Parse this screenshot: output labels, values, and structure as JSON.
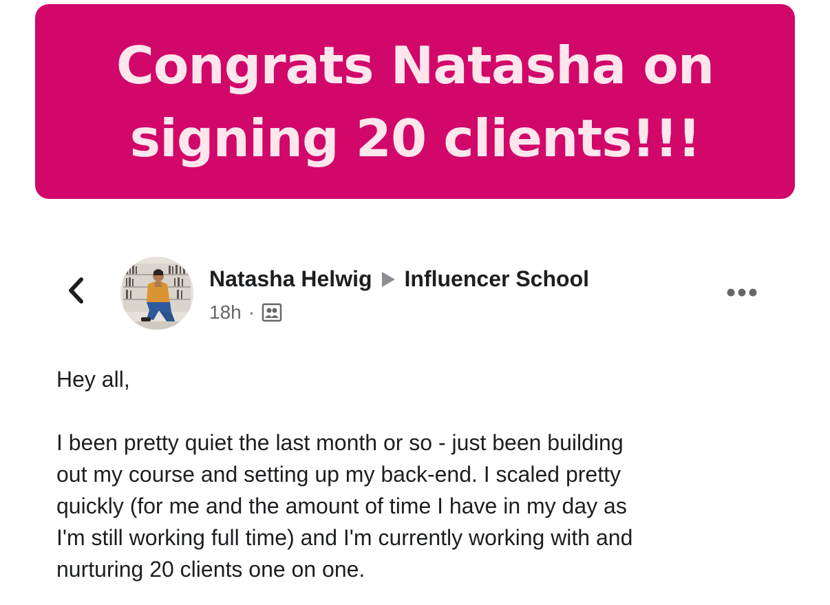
{
  "banner": {
    "title_line1": "Congrats Natasha on",
    "title_line2": "signing 20 clients!!!",
    "background": "#d1076a",
    "text_color": "#fde6ec"
  },
  "post": {
    "back_icon": "chevron-left-icon",
    "avatar_icon": "avatar",
    "author": "Natasha Helwig",
    "group": "Influencer School",
    "timestamp": "18h",
    "separator": "·",
    "audience_icon": "group-members-icon",
    "more_icon": "more-horizontal-icon",
    "greeting": "Hey all,",
    "body_lines": [
      "I been pretty quiet the last month or so - just been building",
      "out my course and setting up my back-end.  I scaled pretty",
      "quickly (for me and the amount of time I have in my day as",
      "I'm still working full time) and I'm currently working with and",
      "nurturing 20 clients one on one."
    ]
  }
}
